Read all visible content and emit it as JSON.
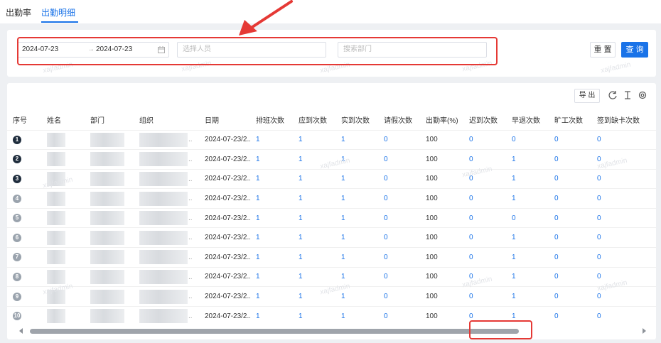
{
  "tabs": [
    {
      "label": "出勤率"
    },
    {
      "label": "出勤明细"
    }
  ],
  "filters": {
    "date_start": "2024-07-23",
    "date_separator": "→",
    "date_end": "2024-07-23",
    "person_placeholder": "选择人员",
    "dept_placeholder": "搜索部门",
    "reset_label": "重 置",
    "query_label": "查 询"
  },
  "toolbar": {
    "export_label": "导 出",
    "icons": [
      "refresh-icon",
      "column-height-icon",
      "settings-icon"
    ]
  },
  "watermark_text": "xajfadmin",
  "table": {
    "headers": [
      "序号",
      "姓名",
      "部门",
      "组织",
      "日期",
      "排班次数",
      "应到次数",
      "实到次数",
      "请假次数",
      "出勤率(%)",
      "迟到次数",
      "早退次数",
      "旷工次数",
      "签到缺卡次数"
    ],
    "rows": [
      {
        "idx": "1",
        "date": "2024-07-23/2...",
        "c1": "1",
        "c2": "1",
        "c3": "1",
        "c4": "0",
        "rate": "100",
        "c5": "0",
        "c6": "0",
        "c7": "0",
        "c8": "0"
      },
      {
        "idx": "2",
        "date": "2024-07-23/2...",
        "c1": "1",
        "c2": "1",
        "c3": "1",
        "c4": "0",
        "rate": "100",
        "c5": "0",
        "c6": "1",
        "c7": "0",
        "c8": "0"
      },
      {
        "idx": "3",
        "date": "2024-07-23/2...",
        "c1": "1",
        "c2": "1",
        "c3": "1",
        "c4": "0",
        "rate": "100",
        "c5": "0",
        "c6": "1",
        "c7": "0",
        "c8": "0"
      },
      {
        "idx": "4",
        "date": "2024-07-23/2...",
        "c1": "1",
        "c2": "1",
        "c3": "1",
        "c4": "0",
        "rate": "100",
        "c5": "0",
        "c6": "1",
        "c7": "0",
        "c8": "0"
      },
      {
        "idx": "5",
        "date": "2024-07-23/2...",
        "c1": "1",
        "c2": "1",
        "c3": "1",
        "c4": "0",
        "rate": "100",
        "c5": "0",
        "c6": "0",
        "c7": "0",
        "c8": "0"
      },
      {
        "idx": "6",
        "date": "2024-07-23/2...",
        "c1": "1",
        "c2": "1",
        "c3": "1",
        "c4": "0",
        "rate": "100",
        "c5": "0",
        "c6": "1",
        "c7": "0",
        "c8": "0"
      },
      {
        "idx": "7",
        "date": "2024-07-23/2...",
        "c1": "1",
        "c2": "1",
        "c3": "1",
        "c4": "0",
        "rate": "100",
        "c5": "0",
        "c6": "1",
        "c7": "0",
        "c8": "0"
      },
      {
        "idx": "8",
        "date": "2024-07-23/2...",
        "c1": "1",
        "c2": "1",
        "c3": "1",
        "c4": "0",
        "rate": "100",
        "c5": "0",
        "c6": "1",
        "c7": "0",
        "c8": "0"
      },
      {
        "idx": "9",
        "date": "2024-07-23/2...",
        "c1": "1",
        "c2": "1",
        "c3": "1",
        "c4": "0",
        "rate": "100",
        "c5": "0",
        "c6": "1",
        "c7": "0",
        "c8": "0"
      },
      {
        "idx": "10",
        "date": "2024-07-23/2...",
        "c1": "1",
        "c2": "1",
        "c3": "1",
        "c4": "0",
        "rate": "100",
        "c5": "0",
        "c6": "1",
        "c7": "0",
        "c8": "0"
      }
    ]
  },
  "scrollbar": {
    "position": 0.0
  },
  "colors": {
    "accent": "#1a73e8",
    "annotation": "#e53935"
  }
}
